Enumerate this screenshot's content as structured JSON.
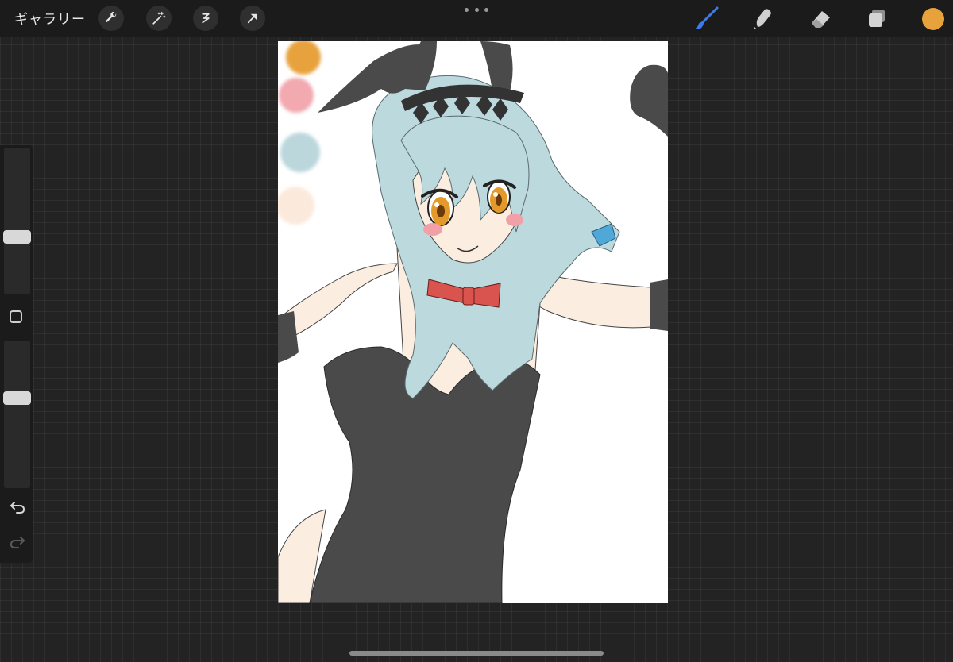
{
  "topbar": {
    "gallery_label": "ギャラリー",
    "tools": [
      "wrench-icon",
      "magic-wand-icon",
      "selection-icon",
      "transform-arrow-icon"
    ],
    "right_tools": [
      "brush-icon",
      "smudge-icon",
      "eraser-icon",
      "layers-icon"
    ],
    "current_color": "#E8A23C",
    "active_tool_color": "#3B7BF0"
  },
  "palette": {
    "swatches": [
      "#E8A23C",
      "#F2A9B0",
      "#BCD7DC",
      "#FBE9DC"
    ]
  },
  "sidebar": {
    "brush_size_level": 0.38,
    "opacity_level": 0.62
  },
  "colors": {
    "ui_bg": "#232323",
    "toolbar_bg": "#1b1b1b",
    "hair": "#BCD9DE",
    "skin": "#FCEDE1",
    "suit": "#4A4A4A",
    "bowtie": "#D9534F",
    "eyes": "#E49A2A",
    "hair_ribbon": "#4FA8D8"
  }
}
